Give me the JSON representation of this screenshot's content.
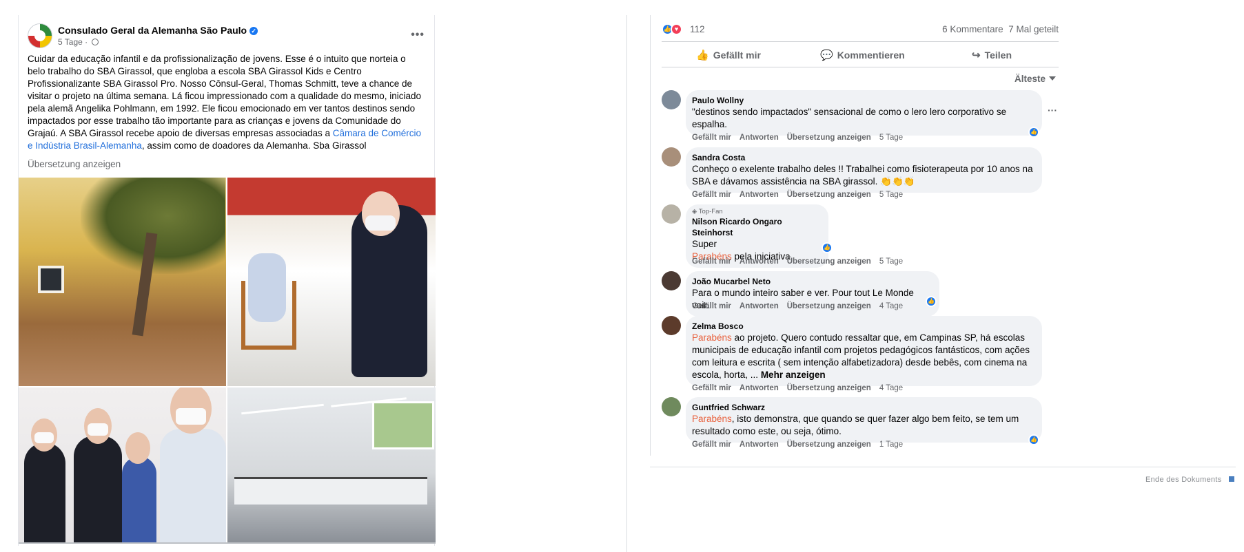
{
  "post": {
    "page_name": "Consulado Geral da Alemanha São Paulo",
    "time": "5 Tage",
    "separator": "·",
    "text_main": "Cuidar da educação infantil e da profissionalização de jovens. Esse  é o intuito que norteia o belo trabalho do SBA Girassol, que engloba a escola SBA Girassol Kids e Centro Profissionalizante SBA Girassol Pro. Nosso Cônsul-Geral, Thomas Schmitt, teve a chance de visitar o projeto na última semana. Lá ficou impressionado com a qualidade do mesmo, iniciado pela alemã Angelika Pohlmann, em 1992. Ele ficou emocionado em ver tantos destinos sendo impactados por esse trabalho tão importante para as crianças e jovens da Comunidade do Grajaú. A SBA Girassol recebe apoio de diversas empresas associadas a ",
    "text_link": "Câmara de Comércio e Indústria Brasil-Alemanha",
    "text_end": ", assim como de doadores da Alemanha. Sba Girassol",
    "translate": "Übersetzung anzeigen"
  },
  "stats": {
    "reaction_count": "112",
    "comments": "6 Kommentare",
    "shares": "7 Mal geteilt"
  },
  "actions": {
    "like": "Gefällt mir",
    "comment": "Kommentieren",
    "share": "Teilen"
  },
  "sort": {
    "label": "Älteste"
  },
  "comment_actions": {
    "like": "Gefällt mir",
    "reply": "Antworten",
    "translate": "Übersetzung anzeigen"
  },
  "comments": [
    {
      "author": "Paulo Wollny",
      "text": "\"destinos sendo impactados\" sensacional de como o lero lero corporativo se espalha.",
      "time": "5 Tage"
    },
    {
      "author": "Sandra Costa",
      "text": "Conheço o exelente trabalho deles !! Trabalhei como fisioterapeuta por 10 anos na SBA e dávamos assistência na SBA girassol. 👏👏👏",
      "time": "5 Tage"
    },
    {
      "badge": "Top-Fan",
      "author": "Nilson Ricardo Ongaro Steinhorst",
      "line1": "Super",
      "highlight": "Parabéns",
      "text": " pela iniciativa",
      "time": "5 Tage"
    },
    {
      "author": "João Mucarbel Neto",
      "text": "Para o mundo inteiro saber e ver. Pour tout Le Monde voir.",
      "time": "4 Tage"
    },
    {
      "author": "Zelma Bosco",
      "highlight": "Parabéns",
      "text": " ao projeto. Quero contudo ressaltar que, em Campinas SP, há escolas municipais de educação infantil com projetos pedagógicos fantásticos, com ações com leitura e escrita ( sem intenção alfabetizadora) desde bebês, com cinema na escola, horta, ... ",
      "more": "Mehr anzeigen",
      "time": "4 Tage"
    },
    {
      "author": "Guntfried Schwarz",
      "highlight": "Parabéns",
      "text": ", isto demonstra, que quando se quer fazer algo bem feito, se tem um resultado como este, ou seja, ótimo.",
      "time": "1 Tage"
    }
  ],
  "footer": {
    "end_text": "Ende des Dokuments"
  },
  "colors": {
    "accent": "#1877f2",
    "love": "#f33e58",
    "highlight": "#e8603c",
    "bubble": "#f0f2f5",
    "secondary_text": "#65676b"
  }
}
